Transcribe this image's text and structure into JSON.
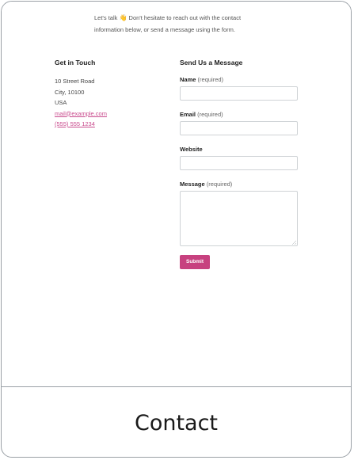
{
  "intro": {
    "prefix": "Let's talk",
    "emoji": "👋",
    "line1_rest": "Don't hesitate to reach out with the contact",
    "line2": "information below, or send a message using the form."
  },
  "contact": {
    "heading": "Get in Touch",
    "address_line1": "10 Street Road",
    "address_line2": "City, 10100",
    "address_line3": "USA",
    "email": "mail@example.com",
    "phone": "(555) 555 1234"
  },
  "form": {
    "heading": "Send Us a Message",
    "name_label": "Name",
    "email_label": "Email",
    "website_label": "Website",
    "message_label": "Message",
    "required_text": "(required)",
    "submit_label": "Submit"
  },
  "caption": "Contact",
  "colors": {
    "accent": "#c7417f",
    "link": "#c94b8d",
    "border": "#9aa0a6"
  }
}
